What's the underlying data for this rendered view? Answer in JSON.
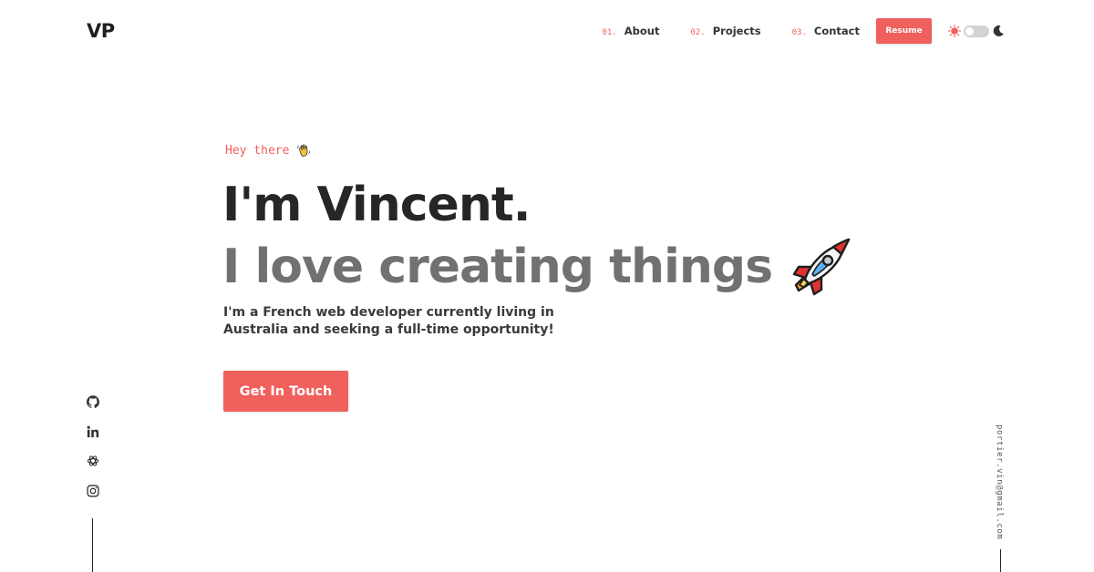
{
  "brand": {
    "logo": "VP"
  },
  "nav": {
    "items": [
      {
        "number": "01.",
        "label": "About"
      },
      {
        "number": "02.",
        "label": "Projects"
      },
      {
        "number": "03.",
        "label": "Contact"
      }
    ],
    "resume_label": "Resume",
    "theme_toggle": {
      "mode": "light",
      "icons": [
        "sun-icon",
        "moon-icon"
      ]
    }
  },
  "hero": {
    "greeting": "Hey there",
    "greeting_icon": "waving-hand-icon",
    "headline": "I'm Vincent.",
    "tagline": "I love creating things",
    "tagline_icon": "rocket-icon",
    "intro": "I'm a French web developer currently living in Australia and seeking a full-time opportunity!",
    "cta_label": "Get In Touch"
  },
  "socials": [
    "github-icon",
    "linkedin-icon",
    "openai-icon",
    "instagram-icon"
  ],
  "email": "portier.vin@gmail.com",
  "colors": {
    "accent": "#f0605d",
    "heading": "#262626",
    "tagline": "#717171",
    "toggle_track": "#d3d3d3"
  }
}
